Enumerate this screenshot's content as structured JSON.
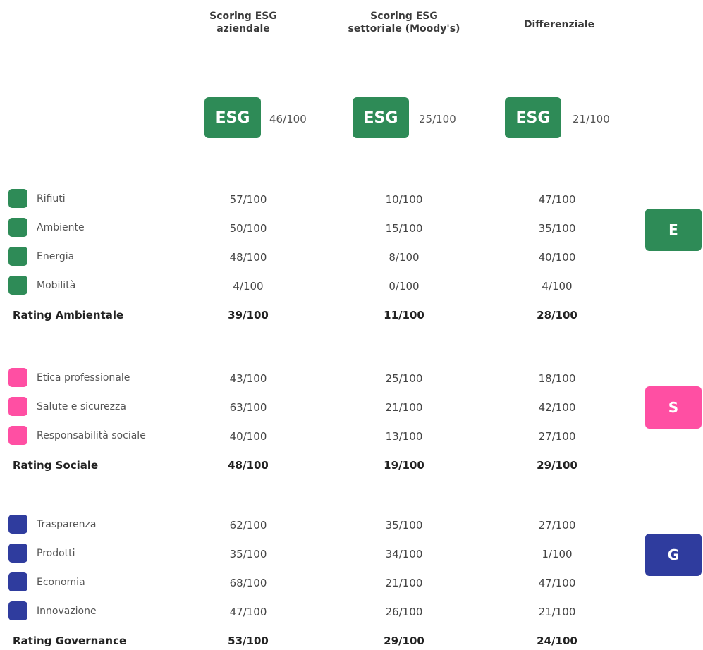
{
  "headers": {
    "company": "Scoring ESG\naziendale",
    "sector": "Scoring ESG\nsettoriale (Moody's)",
    "diff": "Differenziale"
  },
  "esg_badge_label": "ESG",
  "overall": {
    "company": "46/100",
    "sector": "25/100",
    "diff": "21/100"
  },
  "colors": {
    "E": "#2e8b57",
    "S": "#ff4fa3",
    "G": "#2f3c9e"
  },
  "sections": {
    "E": {
      "tag": "E",
      "items": [
        {
          "label": "Rifiuti",
          "company": "57/100",
          "sector": "10/100",
          "diff": "47/100"
        },
        {
          "label": "Ambiente",
          "company": "50/100",
          "sector": "15/100",
          "diff": "35/100"
        },
        {
          "label": "Energia",
          "company": "48/100",
          "sector": "8/100",
          "diff": "40/100"
        },
        {
          "label": "Mobilità",
          "company": "4/100",
          "sector": "0/100",
          "diff": "4/100"
        }
      ],
      "rating": {
        "label": "Rating Ambientale",
        "company": "39/100",
        "sector": "11/100",
        "diff": "28/100"
      }
    },
    "S": {
      "tag": "S",
      "items": [
        {
          "label": "Etica professionale",
          "company": "43/100",
          "sector": "25/100",
          "diff": "18/100"
        },
        {
          "label": "Salute e sicurezza",
          "company": "63/100",
          "sector": "21/100",
          "diff": "42/100"
        },
        {
          "label": "Responsabilità sociale",
          "company": "40/100",
          "sector": "13/100",
          "diff": "27/100"
        }
      ],
      "rating": {
        "label": "Rating Sociale",
        "company": "48/100",
        "sector": "19/100",
        "diff": "29/100"
      }
    },
    "G": {
      "tag": "G",
      "items": [
        {
          "label": "Trasparenza",
          "company": "62/100",
          "sector": "35/100",
          "diff": "27/100"
        },
        {
          "label": "Prodotti",
          "company": "35/100",
          "sector": "34/100",
          "diff": "1/100"
        },
        {
          "label": "Economia",
          "company": "68/100",
          "sector": "21/100",
          "diff": "47/100"
        },
        {
          "label": "Innovazione",
          "company": "47/100",
          "sector": "26/100",
          "diff": "21/100"
        }
      ],
      "rating": {
        "label": "Rating Governance",
        "company": "53/100",
        "sector": "29/100",
        "diff": "24/100"
      }
    }
  }
}
